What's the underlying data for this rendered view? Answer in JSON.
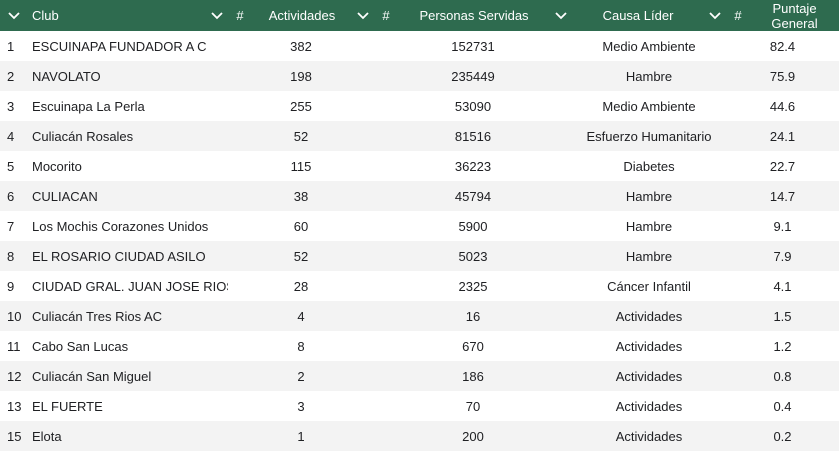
{
  "header": {
    "club_label": "Club",
    "actividades_label": "Actividades",
    "personas_label": "Personas Servidas",
    "causa_label": "Causa Líder",
    "puntaje_label": "Puntaje General",
    "hash_symbol": "#"
  },
  "rows": [
    {
      "idx": "1",
      "club": "ESCUINAPA FUNDADOR A C",
      "actividades": "382",
      "personas": "152731",
      "causa": "Medio Ambiente",
      "puntaje": "82.4"
    },
    {
      "idx": "2",
      "club": "NAVOLATO",
      "actividades": "198",
      "personas": "235449",
      "causa": "Hambre",
      "puntaje": "75.9"
    },
    {
      "idx": "3",
      "club": "Escuinapa La Perla",
      "actividades": "255",
      "personas": "53090",
      "causa": "Medio Ambiente",
      "puntaje": "44.6"
    },
    {
      "idx": "4",
      "club": "Culiacán Rosales",
      "actividades": "52",
      "personas": "81516",
      "causa": "Esfuerzo Humanitario",
      "puntaje": "24.1"
    },
    {
      "idx": "5",
      "club": "Mocorito",
      "actividades": "115",
      "personas": "36223",
      "causa": "Diabetes",
      "puntaje": "22.7"
    },
    {
      "idx": "6",
      "club": "CULIACAN",
      "actividades": "38",
      "personas": "45794",
      "causa": "Hambre",
      "puntaje": "14.7"
    },
    {
      "idx": "7",
      "club": "Los Mochis Corazones Unidos",
      "actividades": "60",
      "personas": "5900",
      "causa": "Hambre",
      "puntaje": "9.1"
    },
    {
      "idx": "8",
      "club": "EL ROSARIO CIUDAD ASILO",
      "actividades": "52",
      "personas": "5023",
      "causa": "Hambre",
      "puntaje": "7.9"
    },
    {
      "idx": "9",
      "club": "CIUDAD GRAL. JUAN JOSE RIOS",
      "actividades": "28",
      "personas": "2325",
      "causa": "Cáncer Infantil",
      "puntaje": "4.1"
    },
    {
      "idx": "10",
      "club": "Culiacán Tres Rios AC",
      "actividades": "4",
      "personas": "16",
      "causa": "Actividades",
      "puntaje": "1.5"
    },
    {
      "idx": "11",
      "club": "Cabo San Lucas",
      "actividades": "8",
      "personas": "670",
      "causa": "Actividades",
      "puntaje": "1.2"
    },
    {
      "idx": "12",
      "club": "Culiacán San Miguel",
      "actividades": "2",
      "personas": "186",
      "causa": "Actividades",
      "puntaje": "0.8"
    },
    {
      "idx": "13",
      "club": "EL FUERTE",
      "actividades": "3",
      "personas": "70",
      "causa": "Actividades",
      "puntaje": "0.4"
    },
    {
      "idx": "15",
      "club": "Elota",
      "actividades": "1",
      "personas": "200",
      "causa": "Actividades",
      "puntaje": "0.2"
    }
  ],
  "colors": {
    "header_bg": "#2e6b4f",
    "header_text": "#ffffff",
    "row_alt_bg": "#f3f3f3"
  },
  "icons": {
    "sort": "chevron-down-icon"
  }
}
